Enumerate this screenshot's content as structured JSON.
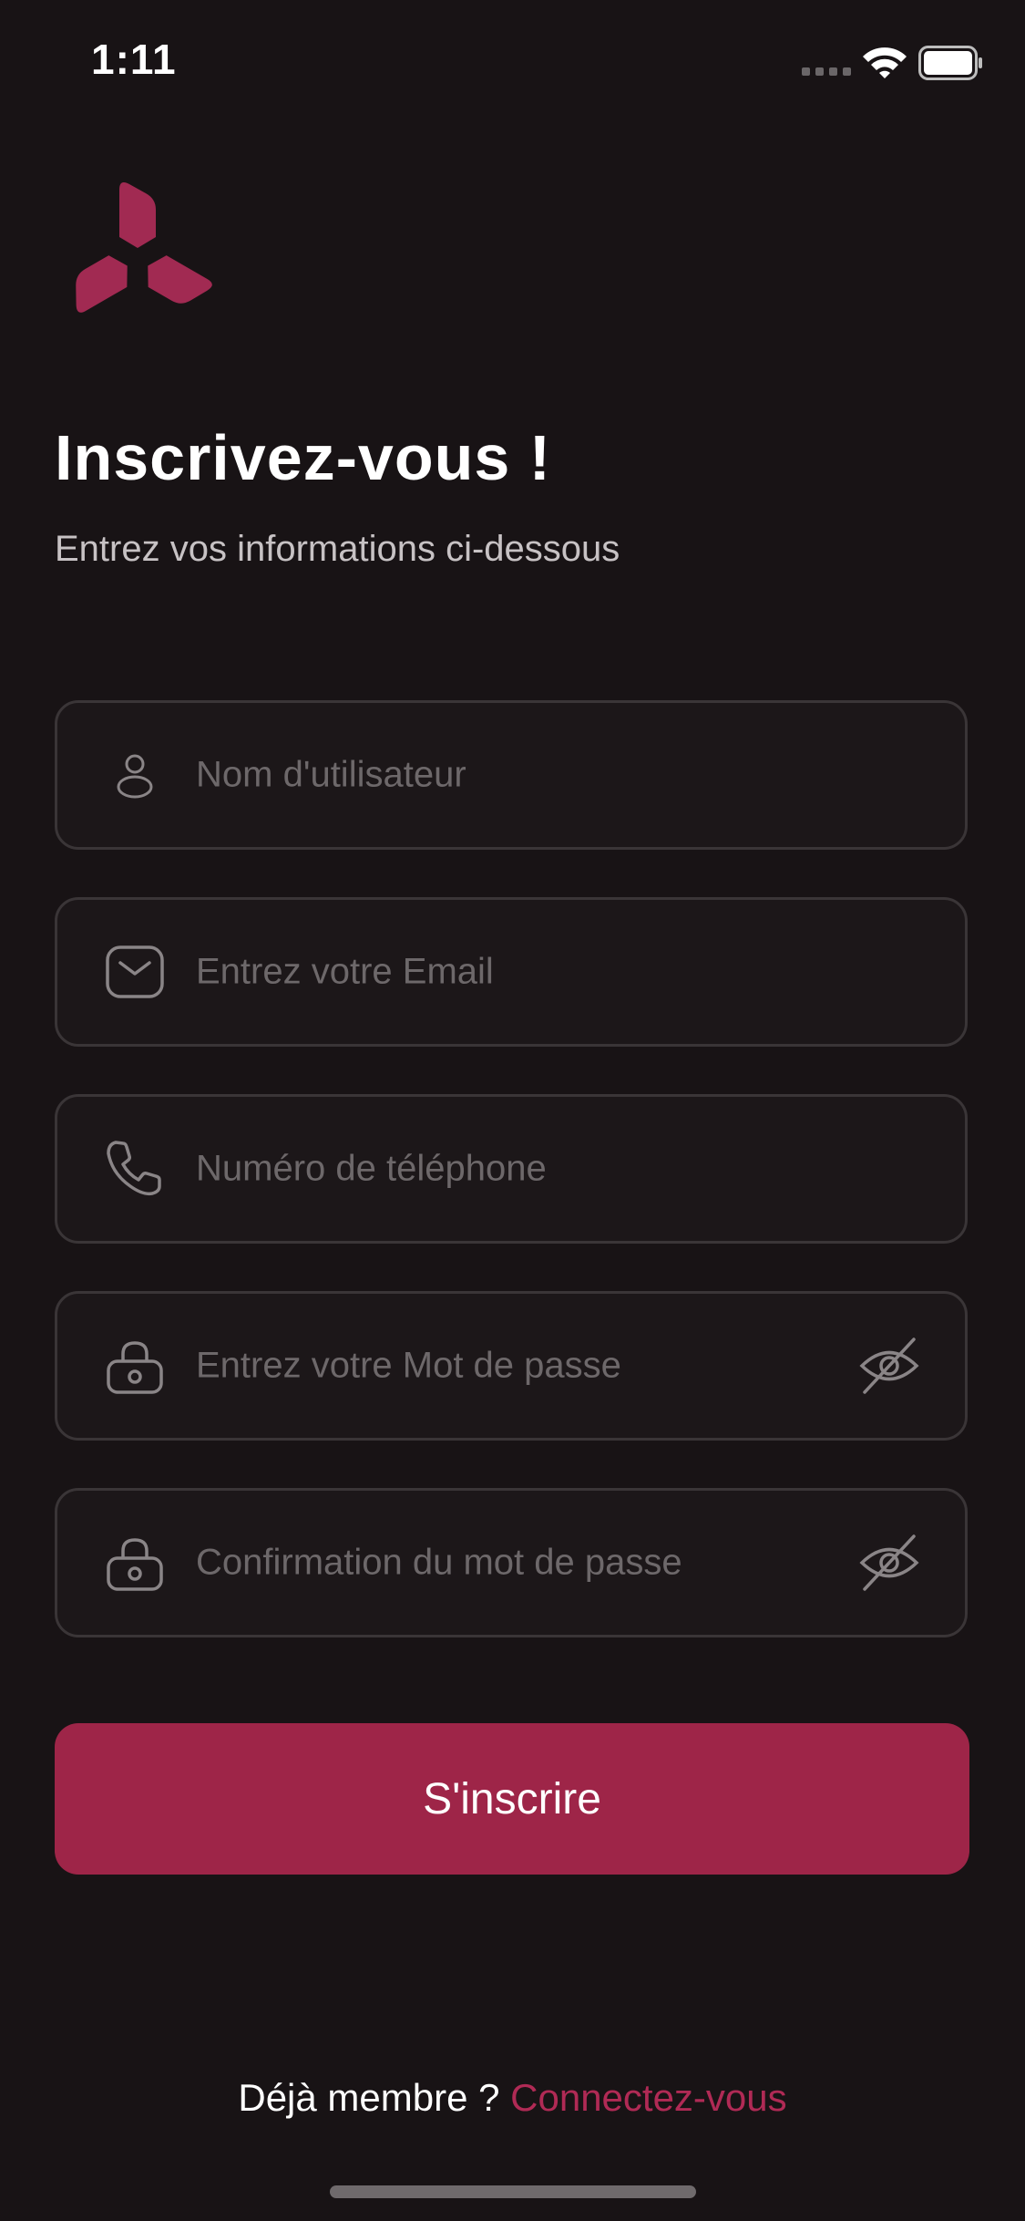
{
  "status_bar": {
    "time": "1:11"
  },
  "header": {
    "title": "Inscrivez-vous !",
    "subtitle": "Entrez vos informations ci-dessous"
  },
  "form": {
    "username_placeholder": "Nom d'utilisateur",
    "email_placeholder": "Entrez votre Email",
    "phone_placeholder": "Numéro de téléphone",
    "password_placeholder": "Entrez votre Mot de passe",
    "confirm_placeholder": "Confirmation du mot de passe",
    "submit_label": "S'inscrire"
  },
  "footer": {
    "question": "Déjà membre ?",
    "link": "Connectez-vous"
  },
  "icons": [
    "user-icon",
    "mail-icon",
    "phone-icon",
    "lock-icon",
    "eye-off-icon"
  ],
  "colors": {
    "background": "#181315",
    "accent": "#9e2548",
    "link": "#b02a55",
    "field_border": "#3a3537",
    "placeholder": "#6d686a"
  }
}
